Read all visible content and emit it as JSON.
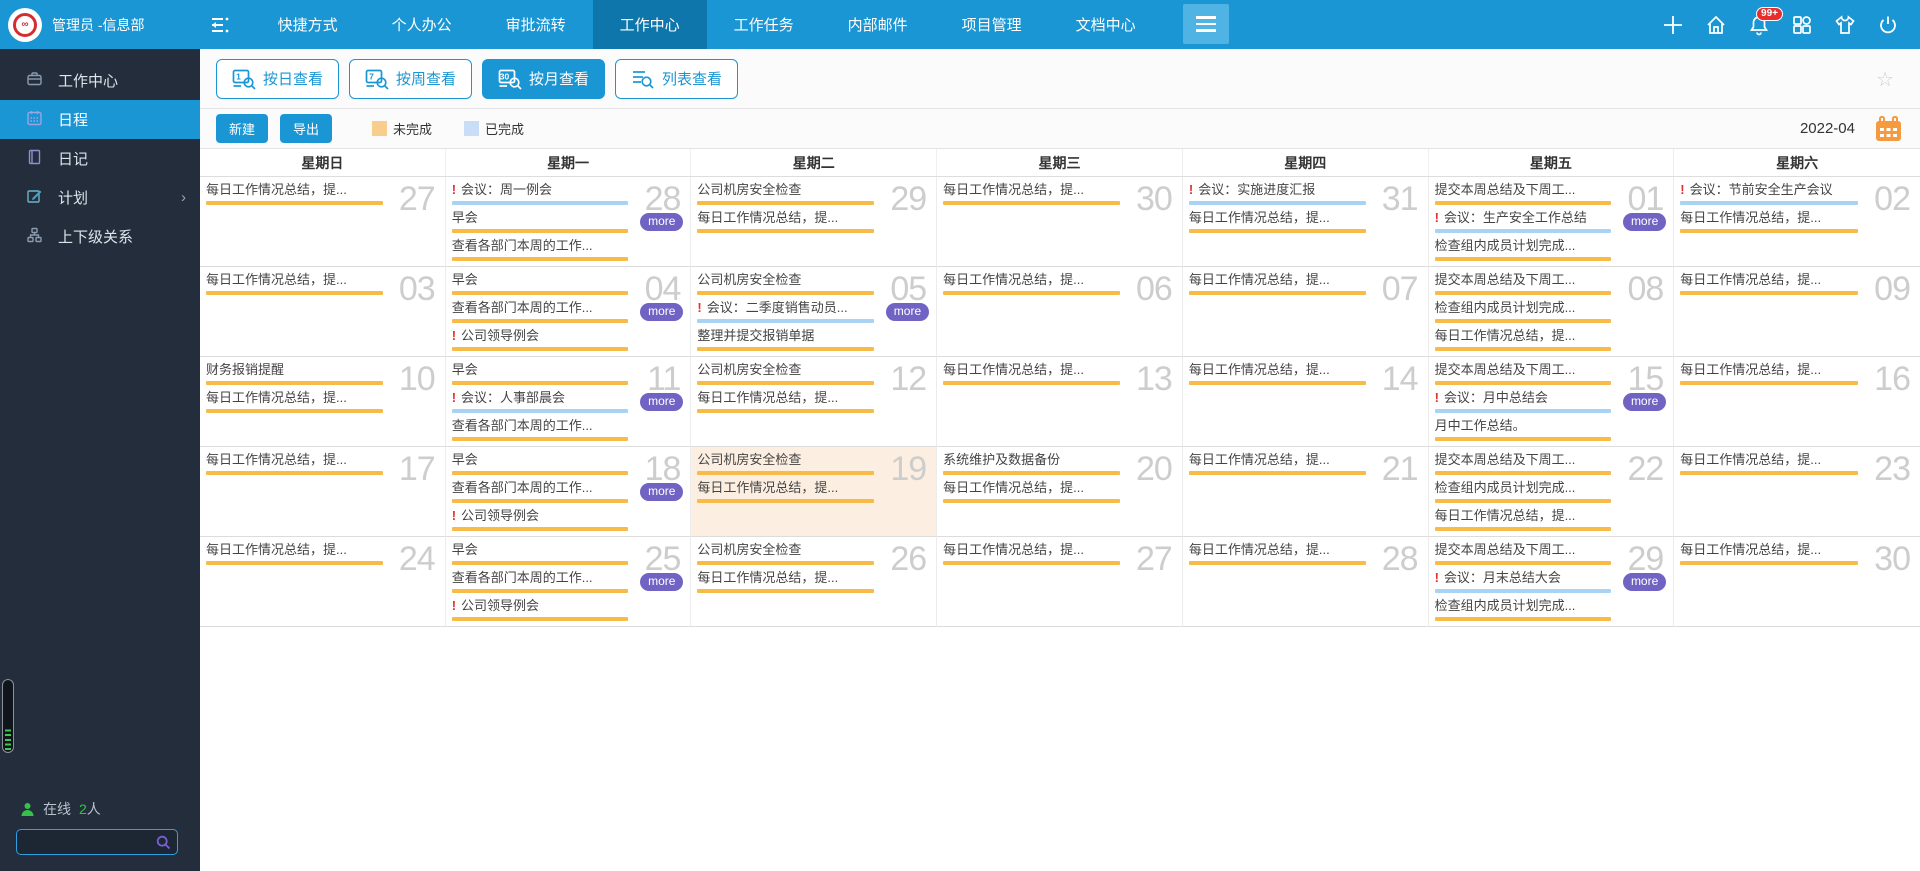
{
  "topbar": {
    "user": "管理员 -信息部",
    "nav": [
      {
        "label": "快捷方式",
        "active": false
      },
      {
        "label": "个人办公",
        "active": false
      },
      {
        "label": "审批流转",
        "active": false
      },
      {
        "label": "工作中心",
        "active": true
      },
      {
        "label": "工作任务",
        "active": false
      },
      {
        "label": "内部邮件",
        "active": false
      },
      {
        "label": "项目管理",
        "active": false
      },
      {
        "label": "文档中心",
        "active": false
      }
    ],
    "icons": [
      "plus-icon",
      "home-icon",
      "bell-icon",
      "apps-grid-icon",
      "shirt-icon",
      "power-icon"
    ],
    "notification_badge": "99+"
  },
  "sidebar": {
    "items": [
      {
        "label": "工作中心",
        "icon": "briefcase-icon",
        "active": false,
        "has_submenu": false
      },
      {
        "label": "日程",
        "icon": "calendar-icon",
        "active": true,
        "has_submenu": false
      },
      {
        "label": "日记",
        "icon": "diary-icon",
        "active": false,
        "has_submenu": false
      },
      {
        "label": "计划",
        "icon": "plan-edit-icon",
        "active": false,
        "has_submenu": true
      },
      {
        "label": "上下级关系",
        "icon": "hierarchy-icon",
        "active": false,
        "has_submenu": false
      }
    ],
    "online_label": "在线",
    "online_count": "2",
    "online_unit": "人",
    "search_placeholder": ""
  },
  "toolbar": {
    "views": [
      {
        "label": "按日查看",
        "glyph": "1",
        "active": false
      },
      {
        "label": "按周查看",
        "glyph": "7",
        "active": false
      },
      {
        "label": "按月查看",
        "glyph": "30",
        "active": true
      },
      {
        "label": "列表查看",
        "glyph": "list",
        "active": false
      }
    ],
    "new_label": "新建",
    "export_label": "导出",
    "legend": [
      {
        "label": "未完成",
        "color": "#f8ce8e"
      },
      {
        "label": "已完成",
        "color": "#c9ddf6"
      }
    ],
    "month": "2022-04"
  },
  "calendar": {
    "weekdays": [
      "星期日",
      "星期一",
      "星期二",
      "星期三",
      "星期四",
      "星期五",
      "星期六"
    ],
    "more_label": "more",
    "weeks": [
      [
        {
          "day": "27",
          "events": [
            {
              "title": "每日工作情况总结，提...",
              "status": "undone",
              "important": false
            }
          ],
          "more": false,
          "today": false
        },
        {
          "day": "28",
          "events": [
            {
              "title": "会议：周一例会",
              "status": "done",
              "important": true
            },
            {
              "title": "早会",
              "status": "undone",
              "important": false
            },
            {
              "title": "查看各部门本周的工作...",
              "status": "undone",
              "important": false
            }
          ],
          "more": true,
          "today": false
        },
        {
          "day": "29",
          "events": [
            {
              "title": "公司机房安全检查",
              "status": "undone",
              "important": false
            },
            {
              "title": "每日工作情况总结，提...",
              "status": "undone",
              "important": false
            }
          ],
          "more": false,
          "today": false
        },
        {
          "day": "30",
          "events": [
            {
              "title": "每日工作情况总结，提...",
              "status": "undone",
              "important": false
            }
          ],
          "more": false,
          "today": false
        },
        {
          "day": "31",
          "events": [
            {
              "title": "会议：实施进度汇报",
              "status": "done",
              "important": true
            },
            {
              "title": "每日工作情况总结，提...",
              "status": "undone",
              "important": false
            }
          ],
          "more": false,
          "today": false
        },
        {
          "day": "01",
          "events": [
            {
              "title": "提交本周总结及下周工...",
              "status": "undone",
              "important": false
            },
            {
              "title": "会议：生产安全工作总结",
              "status": "done",
              "important": true
            },
            {
              "title": "检查组内成员计划完成...",
              "status": "undone",
              "important": false
            }
          ],
          "more": true,
          "today": false
        },
        {
          "day": "02",
          "events": [
            {
              "title": "会议：节前安全生产会议",
              "status": "done",
              "important": true
            },
            {
              "title": "每日工作情况总结，提...",
              "status": "undone",
              "important": false
            }
          ],
          "more": false,
          "today": false
        }
      ],
      [
        {
          "day": "03",
          "events": [
            {
              "title": "每日工作情况总结，提...",
              "status": "undone",
              "important": false
            }
          ],
          "more": false,
          "today": false
        },
        {
          "day": "04",
          "events": [
            {
              "title": "早会",
              "status": "undone",
              "important": false
            },
            {
              "title": "查看各部门本周的工作...",
              "status": "undone",
              "important": false
            },
            {
              "title": "公司领导例会",
              "status": "undone",
              "important": true
            }
          ],
          "more": true,
          "today": false
        },
        {
          "day": "05",
          "events": [
            {
              "title": "公司机房安全检查",
              "status": "undone",
              "important": false
            },
            {
              "title": "会议：二季度销售动员...",
              "status": "done",
              "important": true
            },
            {
              "title": "整理并提交报销单据",
              "status": "undone",
              "important": false
            }
          ],
          "more": true,
          "today": false
        },
        {
          "day": "06",
          "events": [
            {
              "title": "每日工作情况总结，提...",
              "status": "undone",
              "important": false
            }
          ],
          "more": false,
          "today": false
        },
        {
          "day": "07",
          "events": [
            {
              "title": "每日工作情况总结，提...",
              "status": "undone",
              "important": false
            }
          ],
          "more": false,
          "today": false
        },
        {
          "day": "08",
          "events": [
            {
              "title": "提交本周总结及下周工...",
              "status": "undone",
              "important": false
            },
            {
              "title": "检查组内成员计划完成...",
              "status": "undone",
              "important": false
            },
            {
              "title": "每日工作情况总结，提...",
              "status": "undone",
              "important": false
            }
          ],
          "more": false,
          "today": false
        },
        {
          "day": "09",
          "events": [
            {
              "title": "每日工作情况总结，提...",
              "status": "undone",
              "important": false
            }
          ],
          "more": false,
          "today": false
        }
      ],
      [
        {
          "day": "10",
          "events": [
            {
              "title": "财务报销提醒",
              "status": "undone",
              "important": false
            },
            {
              "title": "每日工作情况总结，提...",
              "status": "undone",
              "important": false
            }
          ],
          "more": false,
          "today": false
        },
        {
          "day": "11",
          "events": [
            {
              "title": "早会",
              "status": "undone",
              "important": false
            },
            {
              "title": "会议：人事部晨会",
              "status": "done",
              "important": true
            },
            {
              "title": "查看各部门本周的工作...",
              "status": "undone",
              "important": false
            }
          ],
          "more": true,
          "today": false
        },
        {
          "day": "12",
          "events": [
            {
              "title": "公司机房安全检查",
              "status": "undone",
              "important": false
            },
            {
              "title": "每日工作情况总结，提...",
              "status": "undone",
              "important": false
            }
          ],
          "more": false,
          "today": false
        },
        {
          "day": "13",
          "events": [
            {
              "title": "每日工作情况总结，提...",
              "status": "undone",
              "important": false
            }
          ],
          "more": false,
          "today": false
        },
        {
          "day": "14",
          "events": [
            {
              "title": "每日工作情况总结，提...",
              "status": "undone",
              "important": false
            }
          ],
          "more": false,
          "today": false
        },
        {
          "day": "15",
          "events": [
            {
              "title": "提交本周总结及下周工...",
              "status": "undone",
              "important": false
            },
            {
              "title": "会议：月中总结会",
              "status": "done",
              "important": true
            },
            {
              "title": "月中工作总结。",
              "status": "undone",
              "important": false
            }
          ],
          "more": true,
          "today": false
        },
        {
          "day": "16",
          "events": [
            {
              "title": "每日工作情况总结，提...",
              "status": "undone",
              "important": false
            }
          ],
          "more": false,
          "today": false
        }
      ],
      [
        {
          "day": "17",
          "events": [
            {
              "title": "每日工作情况总结，提...",
              "status": "undone",
              "important": false
            }
          ],
          "more": false,
          "today": false
        },
        {
          "day": "18",
          "events": [
            {
              "title": "早会",
              "status": "undone",
              "important": false
            },
            {
              "title": "查看各部门本周的工作...",
              "status": "undone",
              "important": false
            },
            {
              "title": "公司领导例会",
              "status": "undone",
              "important": true
            }
          ],
          "more": true,
          "today": false
        },
        {
          "day": "19",
          "events": [
            {
              "title": "公司机房安全检查",
              "status": "undone",
              "important": false
            },
            {
              "title": "每日工作情况总结，提...",
              "status": "undone",
              "important": false
            }
          ],
          "more": false,
          "today": true
        },
        {
          "day": "20",
          "events": [
            {
              "title": "系统维护及数据备份",
              "status": "undone",
              "important": false
            },
            {
              "title": "每日工作情况总结，提...",
              "status": "undone",
              "important": false
            }
          ],
          "more": false,
          "today": false
        },
        {
          "day": "21",
          "events": [
            {
              "title": "每日工作情况总结，提...",
              "status": "undone",
              "important": false
            }
          ],
          "more": false,
          "today": false
        },
        {
          "day": "22",
          "events": [
            {
              "title": "提交本周总结及下周工...",
              "status": "undone",
              "important": false
            },
            {
              "title": "检查组内成员计划完成...",
              "status": "undone",
              "important": false
            },
            {
              "title": "每日工作情况总结，提...",
              "status": "undone",
              "important": false
            }
          ],
          "more": false,
          "today": false
        },
        {
          "day": "23",
          "events": [
            {
              "title": "每日工作情况总结，提...",
              "status": "undone",
              "important": false
            }
          ],
          "more": false,
          "today": false
        }
      ],
      [
        {
          "day": "24",
          "events": [
            {
              "title": "每日工作情况总结，提...",
              "status": "undone",
              "important": false
            }
          ],
          "more": false,
          "today": false
        },
        {
          "day": "25",
          "events": [
            {
              "title": "早会",
              "status": "undone",
              "important": false
            },
            {
              "title": "查看各部门本周的工作...",
              "status": "undone",
              "important": false
            },
            {
              "title": "公司领导例会",
              "status": "undone",
              "important": true
            }
          ],
          "more": true,
          "today": false
        },
        {
          "day": "26",
          "events": [
            {
              "title": "公司机房安全检查",
              "status": "undone",
              "important": false
            },
            {
              "title": "每日工作情况总结，提...",
              "status": "undone",
              "important": false
            }
          ],
          "more": false,
          "today": false
        },
        {
          "day": "27",
          "events": [
            {
              "title": "每日工作情况总结，提...",
              "status": "undone",
              "important": false
            }
          ],
          "more": false,
          "today": false
        },
        {
          "day": "28",
          "events": [
            {
              "title": "每日工作情况总结，提...",
              "status": "undone",
              "important": false
            }
          ],
          "more": false,
          "today": false
        },
        {
          "day": "29",
          "events": [
            {
              "title": "提交本周总结及下周工...",
              "status": "undone",
              "important": false
            },
            {
              "title": "会议：月末总结大会",
              "status": "done",
              "important": true
            },
            {
              "title": "检查组内成员计划完成...",
              "status": "undone",
              "important": false
            }
          ],
          "more": true,
          "today": false
        },
        {
          "day": "30",
          "events": [
            {
              "title": "每日工作情况总结，提...",
              "status": "undone",
              "important": false
            }
          ],
          "more": false,
          "today": false
        }
      ]
    ]
  },
  "colors": {
    "topbar": "#1a96d4",
    "topbar_active": "#0e76ab",
    "sidebar": "#232d3b",
    "accent": "#1a96d4",
    "undone_bar": "#f8bb47",
    "done_bar": "#a9d3f4",
    "more_badge": "#7063c3",
    "today_bg": "#fcefe1",
    "badge_red": "#e62e2e",
    "online_green": "#35c24a",
    "calendar_picker_orange": "#f59a3e"
  }
}
